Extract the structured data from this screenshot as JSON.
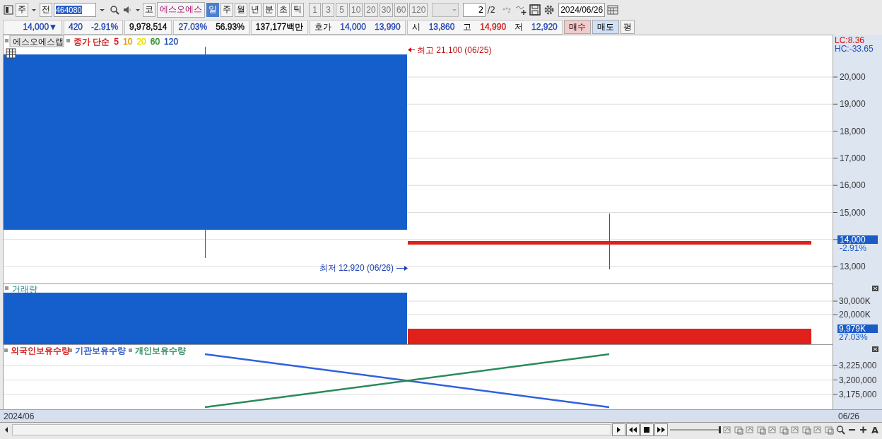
{
  "toolbar": {
    "market": "주",
    "prev": "전",
    "code": "464080",
    "name_prefix": "코",
    "name": "에스오에스",
    "periods": [
      {
        "label": "일",
        "selected": true
      },
      {
        "label": "주",
        "selected": false
      },
      {
        "label": "월",
        "selected": false
      },
      {
        "label": "년",
        "selected": false
      },
      {
        "label": "분",
        "selected": false
      },
      {
        "label": "초",
        "selected": false
      },
      {
        "label": "틱",
        "selected": false
      }
    ],
    "intervals": [
      {
        "label": "1",
        "disabled": true
      },
      {
        "label": "3",
        "disabled": true
      },
      {
        "label": "5",
        "disabled": true
      },
      {
        "label": "10",
        "disabled": true
      },
      {
        "label": "20",
        "disabled": true
      },
      {
        "label": "30",
        "disabled": true
      },
      {
        "label": "60",
        "disabled": true
      },
      {
        "label": "120",
        "disabled": true
      }
    ],
    "page": "2",
    "pages": "/2",
    "date": "2024/06/26"
  },
  "quote": {
    "groups": [
      [
        {
          "text": "14,000▼",
          "color": "#1a3fb0"
        }
      ],
      [
        {
          "text": "420",
          "color": "#1a3fb0"
        },
        {
          "text": "-2.91%",
          "color": "#1a3fb0"
        }
      ],
      [
        {
          "text": "9,978,514",
          "color": "#000000"
        }
      ],
      [
        {
          "text": "27.03%",
          "color": "#1a3fb0"
        },
        {
          "text": "56.93%",
          "color": "#000000"
        }
      ],
      [
        {
          "text": "137,177백만",
          "color": "#000000"
        }
      ],
      [
        {
          "kind": "label",
          "text": "호가"
        },
        {
          "text": "14,000",
          "color": "#1a3fb0"
        },
        {
          "text": "13,990",
          "color": "#1a3fb0"
        }
      ],
      [
        {
          "kind": "label",
          "text": "시"
        },
        {
          "text": "13,860",
          "color": "#1a3fb0"
        },
        {
          "kind": "label",
          "text": "고"
        },
        {
          "text": "14,990",
          "color": "#d01010"
        },
        {
          "kind": "label",
          "text": "저"
        },
        {
          "text": "12,920",
          "color": "#1a3fb0"
        }
      ]
    ],
    "buy": "매수",
    "sell": "매도",
    "avg": "평"
  },
  "price_pane": {
    "title": "에스오에스랩",
    "legend": [
      {
        "text": "종가 단순",
        "color": "#d01010"
      },
      {
        "text": "5",
        "color": "#d01010"
      },
      {
        "text": "10",
        "color": "#e0a000"
      },
      {
        "text": "20",
        "color": "#e8e000"
      },
      {
        "text": "60",
        "color": "#2a8a2a"
      },
      {
        "text": "120",
        "color": "#2050b0"
      }
    ],
    "high_label": "최고 21,100 (06/25)",
    "low_label": "최저 12,920 (06/26)",
    "lc": "LC:8.36",
    "hc": "HC:-33.65",
    "ticks": [
      "20,000",
      "19,000",
      "18,000",
      "17,000",
      "16,000",
      "15,000",
      "13,000"
    ],
    "current": "14,000",
    "change": "-2.91%"
  },
  "volume_pane": {
    "title": "거래량",
    "ticks": [
      "30,000K",
      "20,000K"
    ],
    "current": "9,979K",
    "ratio": "27.03%"
  },
  "holdings_pane": {
    "legend": [
      {
        "text": "외국인보유수량",
        "color": "#d01010"
      },
      {
        "text": "기관보유수량",
        "color": "#2050c0"
      },
      {
        "text": "개인보유수량",
        "color": "#2a8a5a"
      }
    ],
    "ticks": [
      "3,225,000",
      "3,200,000",
      "3,175,000"
    ]
  },
  "date_axis": {
    "start": "2024/06",
    "end": "06/26"
  },
  "bottom_bar": {
    "zoom_slider": {
      "level": 1
    },
    "font_button": "A"
  }
}
